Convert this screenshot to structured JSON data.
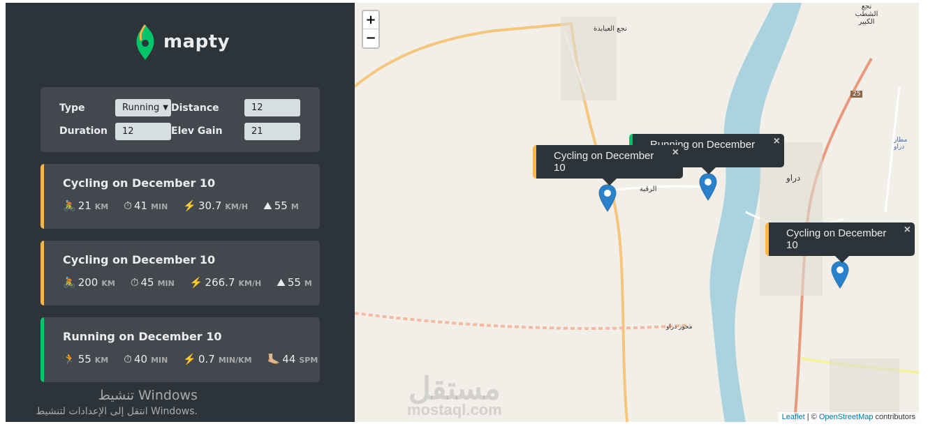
{
  "app": {
    "name": "mapty",
    "accent_running": "#00c46a",
    "accent_cycling": "#ffb545"
  },
  "form": {
    "type_label": "Type",
    "type_value": "Running",
    "distance_label": "Distance",
    "distance_value": "12",
    "duration_label": "Duration",
    "duration_value": "12",
    "elev_label": "Elev Gain",
    "elev_value": "21"
  },
  "workouts": [
    {
      "type": "cycling",
      "title": "Cycling on December 10",
      "stats": [
        {
          "icon": "🚴",
          "value": "21",
          "unit": "KM"
        },
        {
          "icon": "⏱",
          "value": "41",
          "unit": "MIN"
        },
        {
          "icon": "⚡️",
          "value": "30.7",
          "unit": "KM/H"
        },
        {
          "icon": "⛰",
          "value": "55",
          "unit": "M"
        }
      ]
    },
    {
      "type": "cycling",
      "title": "Cycling on December 10",
      "stats": [
        {
          "icon": "🚴",
          "value": "200",
          "unit": "KM"
        },
        {
          "icon": "⏱",
          "value": "45",
          "unit": "MIN"
        },
        {
          "icon": "⚡️",
          "value": "266.7",
          "unit": "KM/H"
        },
        {
          "icon": "⛰",
          "value": "55",
          "unit": "M"
        }
      ]
    },
    {
      "type": "running",
      "title": "Running on December 10",
      "stats": [
        {
          "icon": "🏃",
          "value": "55",
          "unit": "KM"
        },
        {
          "icon": "⏱",
          "value": "40",
          "unit": "MIN"
        },
        {
          "icon": "⚡️",
          "value": "0.7",
          "unit": "MIN/KM"
        },
        {
          "icon": "🦶🏼",
          "value": "44",
          "unit": "SPM"
        }
      ]
    }
  ],
  "windows": {
    "title": "تنشيط Windows",
    "subtitle": "انتقل إلى الإعدادات لتنشيط Windows."
  },
  "map": {
    "zoom_in": "+",
    "zoom_out": "−",
    "popups": [
      {
        "text": "Running on December 10",
        "type": "running"
      },
      {
        "text": "Cycling on December 10",
        "type": "cycling"
      },
      {
        "text": "Cycling on December 10",
        "type": "cycling"
      }
    ],
    "close": "×",
    "labels": [
      "نجع العبابدة",
      "الرقبة",
      "دراو",
      "محوز دراو",
      "نجع الشطب الكبير",
      "مطار دراو",
      "25"
    ],
    "attribution": {
      "leaflet": "Leaflet",
      "sep": " | © ",
      "osm": "OpenStreetMap",
      "suffix": " contributors"
    },
    "watermark": {
      "arabic": "مستقل",
      "latin": "mostaql.com"
    }
  }
}
